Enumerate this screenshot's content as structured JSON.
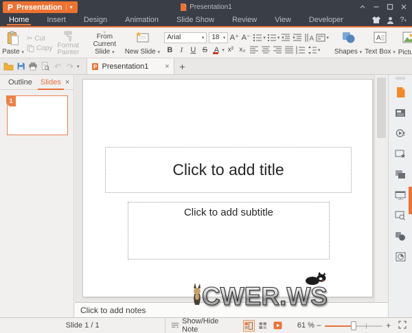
{
  "icons": {
    "caret": "▾",
    "close": "×",
    "plus": "+",
    "scissors": "✂",
    "undo": "↶",
    "redo": "↷",
    "help": "?",
    "expand": "›",
    "superscript": "x²",
    "subscript": "x₂",
    "increase_font": "A⁺",
    "decrease_font": "A⁻",
    "minus": "−"
  },
  "titlebar": {
    "app_logo": "P",
    "app_button": "Presentation",
    "document_title": "Presentation1"
  },
  "menu": {
    "tabs": [
      {
        "label": "Home",
        "active": true
      },
      {
        "label": "Insert",
        "active": false
      },
      {
        "label": "Design",
        "active": false
      },
      {
        "label": "Animation",
        "active": false
      },
      {
        "label": "Slide Show",
        "active": false
      },
      {
        "label": "Review",
        "active": false
      },
      {
        "label": "View",
        "active": false
      },
      {
        "label": "Developer",
        "active": false
      }
    ]
  },
  "ribbon": {
    "paste": "Paste",
    "cut": "Cut",
    "copy": "Copy",
    "format_painter": "Format Painter",
    "from_current_slide": "From Current Slide",
    "new_slide": "New Slide",
    "font_name": "Arial",
    "font_size": "18",
    "bold": "B",
    "italic": "I",
    "underline": "U",
    "strikethrough": "S",
    "font_color": "A",
    "shapes": "Shapes",
    "text_box": "Text Box",
    "picture": "Picture"
  },
  "doc_tab": {
    "title": "Presentation1"
  },
  "left_panel": {
    "outline_tab": "Outline",
    "slides_tab": "Slides",
    "slide_number": "1"
  },
  "slide": {
    "title_placeholder": "Click to add title",
    "subtitle_placeholder": "Click to add subtitle"
  },
  "notes": {
    "placeholder": "Click to add notes"
  },
  "watermark": {
    "text": "CWER.WS"
  },
  "status": {
    "slide_counter": "Slide 1 / 1",
    "show_hide_note": "Show/Hide Note",
    "zoom_value": "61 %"
  },
  "colors": {
    "accent": "#e8743a",
    "titlebar_bg": "#3a3e47",
    "app_button_bg": "#ec7333"
  }
}
